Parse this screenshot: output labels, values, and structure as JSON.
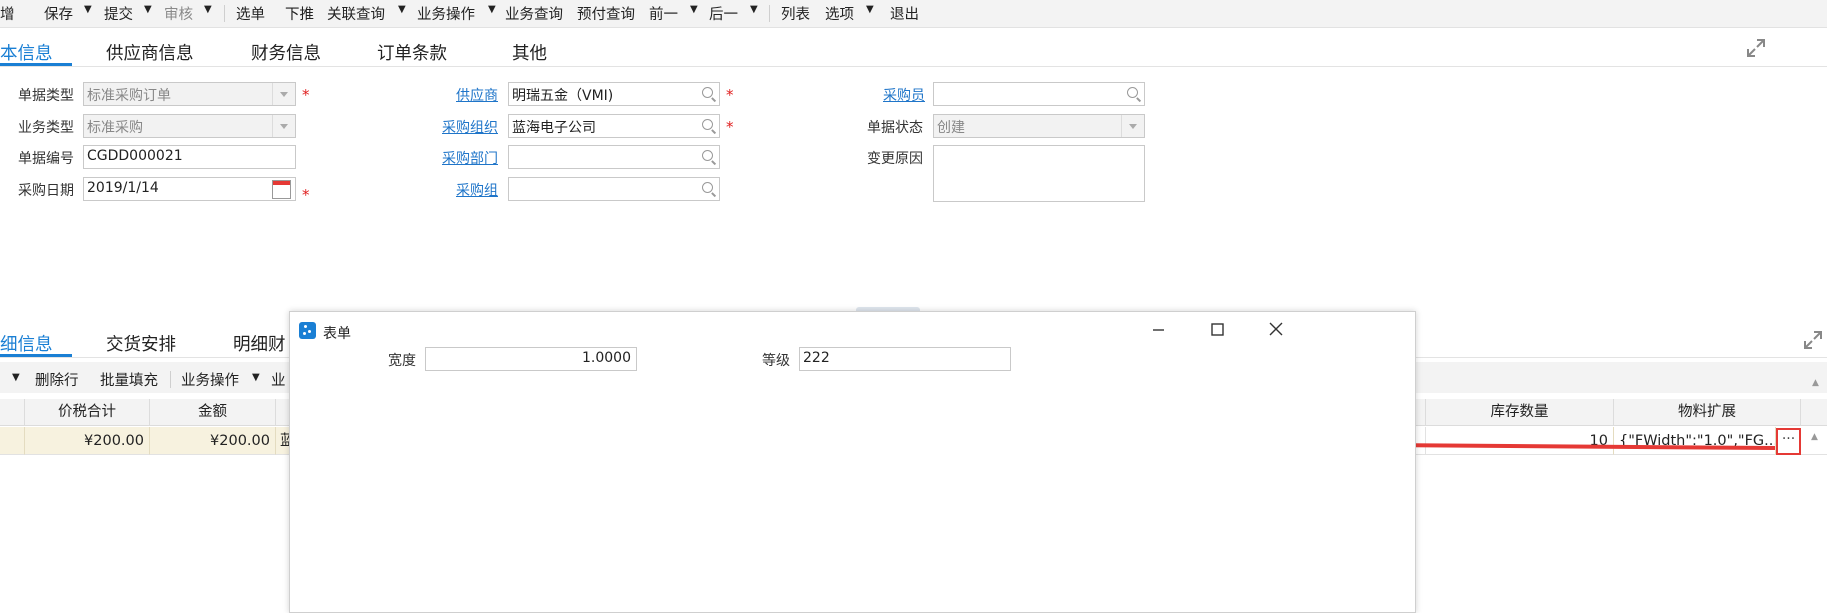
{
  "toolbar": {
    "items": [
      "增",
      "保存",
      "提交",
      "审核",
      "选单",
      "下推",
      "关联查询",
      "业务操作",
      "业务查询",
      "预付查询",
      "前一",
      "后一",
      "列表",
      "选项",
      "退出"
    ]
  },
  "header_tabs": [
    "本信息",
    "供应商信息",
    "财务信息",
    "订单条款",
    "其他"
  ],
  "form": {
    "bill_type": {
      "label": "单据类型",
      "value": "标准采购订单"
    },
    "biz_type": {
      "label": "业务类型",
      "value": "标准采购"
    },
    "bill_no": {
      "label": "单据编号",
      "value": "CGDD000021"
    },
    "purchase_date": {
      "label": "采购日期",
      "value": "2019/1/14"
    },
    "calendar_day": "1",
    "supplier": {
      "label": "供应商",
      "value": "明瑞五金（VMI)"
    },
    "purchase_org": {
      "label": "采购组织",
      "value": "蓝海电子公司"
    },
    "purchase_dept": {
      "label": "采购部门",
      "value": ""
    },
    "purchase_group": {
      "label": "采购组",
      "value": ""
    },
    "buyer": {
      "label": "采购员",
      "value": ""
    },
    "bill_status": {
      "label": "单据状态",
      "value": "创建"
    },
    "change_reason": {
      "label": "变更原因",
      "value": ""
    }
  },
  "detail_tabs": [
    "细信息",
    "交货安排",
    "明细财"
  ],
  "detail_toolbar": [
    "删除行",
    "批量填充",
    "业务操作",
    "业"
  ],
  "grid": {
    "headers": {
      "tax_total": "价税合计",
      "amount": "金额",
      "stock_qty": "库存数量",
      "material_ext": "物料扩展"
    },
    "row": {
      "tax_total": "¥200.00",
      "amount": "¥200.00",
      "col3_partial": "蓝",
      "stock_qty": "10",
      "material_ext": "{\"FWidth\":\"1.0\",\"FG...",
      "ellipsis": "···"
    }
  },
  "dialog": {
    "title": "表单",
    "width_label": "宽度",
    "width_value": "1.0000",
    "grade_label": "等级",
    "grade_value": "222"
  },
  "colors": {
    "accent": "#1a7fd4",
    "link": "#1f75c9",
    "required": "#e02020",
    "arrow": "#e53935",
    "row_highlight": "#f7f2df"
  }
}
